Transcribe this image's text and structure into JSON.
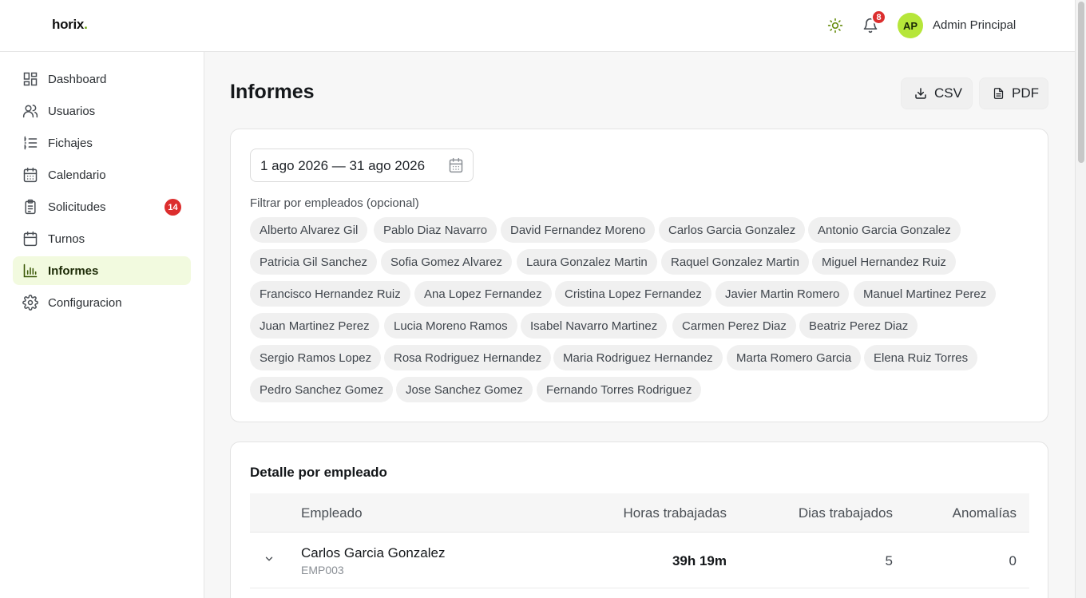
{
  "brand": {
    "name": "horix",
    "dot": "."
  },
  "header": {
    "notifications_count": "8",
    "avatar_initials": "AP",
    "user_name": "Admin Principal"
  },
  "sidebar": {
    "items": [
      {
        "label": "Dashboard",
        "icon": "dashboard-icon"
      },
      {
        "label": "Usuarios",
        "icon": "users-icon"
      },
      {
        "label": "Fichajes",
        "icon": "list-icon"
      },
      {
        "label": "Calendario",
        "icon": "calendar-icon"
      },
      {
        "label": "Solicitudes",
        "icon": "clipboard-icon",
        "badge": "14"
      },
      {
        "label": "Turnos",
        "icon": "calendar-shift-icon"
      },
      {
        "label": "Informes",
        "icon": "bar-chart-icon",
        "active": true
      },
      {
        "label": "Configuracion",
        "icon": "gear-icon"
      }
    ]
  },
  "main": {
    "title": "Informes",
    "csv_label": "CSV",
    "pdf_label": "PDF",
    "date_range": "1 ago 2026 — 31 ago 2026",
    "filter_label": "Filtrar por empleados (opcional)",
    "employees": [
      "Alberto Alvarez Gil",
      "Pablo Diaz Navarro",
      "David Fernandez Moreno",
      "Carlos Garcia Gonzalez",
      "Antonio Garcia Gonzalez",
      "Patricia Gil Sanchez",
      "Sofia Gomez Alvarez",
      "Laura Gonzalez Martin",
      "Raquel Gonzalez Martin",
      "Miguel Hernandez Ruiz",
      "Francisco Hernandez Ruiz",
      "Ana Lopez Fernandez",
      "Cristina Lopez Fernandez",
      "Javier Martin Romero",
      "Manuel Martinez Perez",
      "Juan Martinez Perez",
      "Lucia Moreno Ramos",
      "Isabel Navarro Martinez",
      "Carmen Perez Diaz",
      "Beatriz Perez Diaz",
      "Sergio Ramos Lopez",
      "Rosa Rodriguez Hernandez",
      "Maria Rodriguez Hernandez",
      "Marta Romero Garcia",
      "Elena Ruiz Torres",
      "Pedro Sanchez Gomez",
      "Jose Sanchez Gomez",
      "Fernando Torres Rodriguez"
    ],
    "detail": {
      "title": "Detalle por empleado",
      "columns": {
        "employee": "Empleado",
        "hours": "Horas trabajadas",
        "days": "Dias trabajados",
        "anomalies": "Anomalías"
      },
      "rows": [
        {
          "name": "Carlos Garcia Gonzalez",
          "code": "EMP003",
          "hours": "39h 19m",
          "days": "5",
          "anomalies": "0"
        }
      ]
    }
  },
  "colors": {
    "accent": "#b6e63a",
    "active_bg": "#f2fadf",
    "badge": "#dc2e2e"
  }
}
